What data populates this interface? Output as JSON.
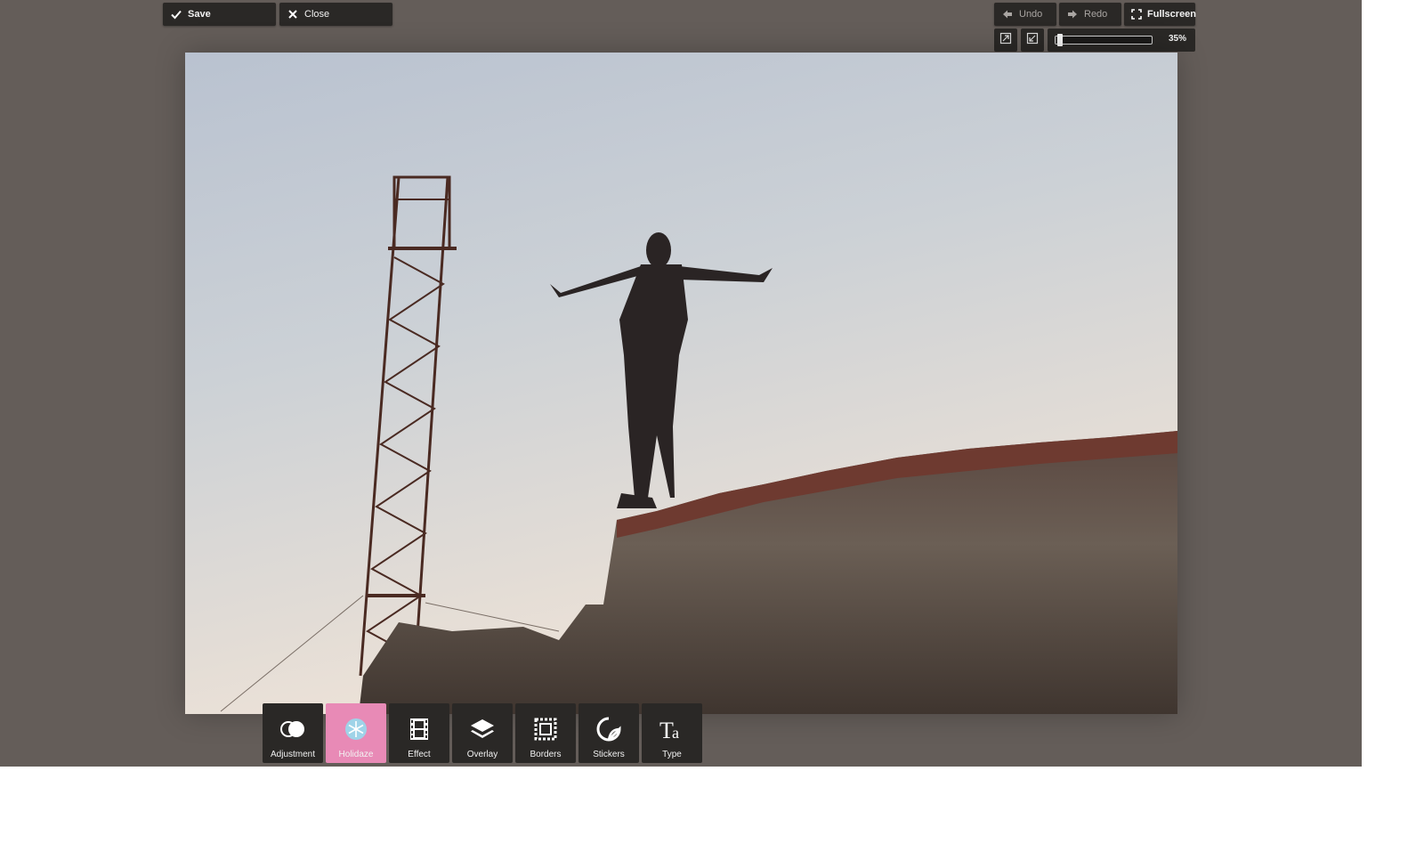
{
  "top_left": {
    "save_label": "Save",
    "close_label": "Close"
  },
  "top_right": {
    "undo_label": "Undo",
    "redo_label": "Redo",
    "fullscreen_label": "Fullscreen",
    "zoom_value": "35%",
    "zoom_fraction": 0.03
  },
  "toolbar": {
    "tools": [
      {
        "label": "Adjustment",
        "icon": "toggle-icon"
      },
      {
        "label": "Holidaze",
        "icon": "snowflake-icon",
        "active": true
      },
      {
        "label": "Effect",
        "icon": "film-icon"
      },
      {
        "label": "Overlay",
        "icon": "layers-icon"
      },
      {
        "label": "Borders",
        "icon": "frame-icon"
      },
      {
        "label": "Stickers",
        "icon": "sticker-icon"
      },
      {
        "label": "Type",
        "icon": "type-icon"
      }
    ]
  },
  "colors": {
    "background": "#645d59",
    "button": "#2a2826",
    "active_tool": "#e88ab6"
  }
}
